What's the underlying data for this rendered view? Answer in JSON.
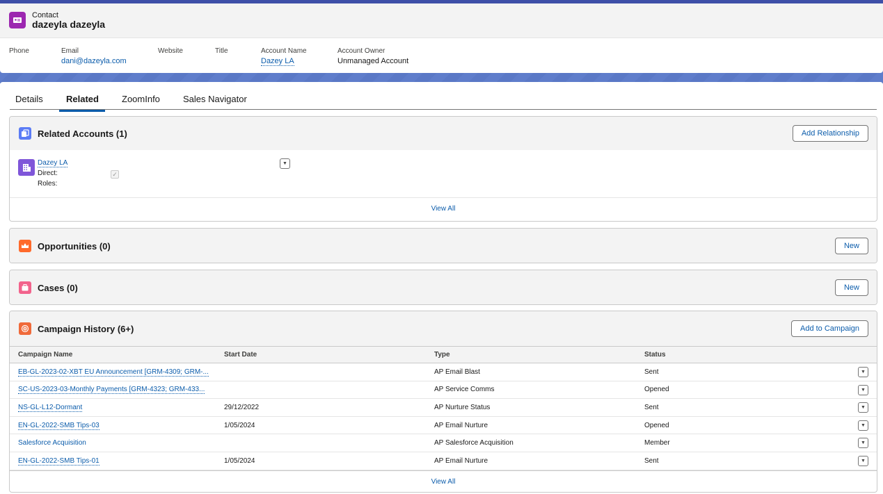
{
  "header": {
    "object_type": "Contact",
    "record_name": "dazeyla dazeyla",
    "fields": [
      {
        "label": "Phone",
        "value": ""
      },
      {
        "label": "Email",
        "value": "dani@dazeyla.com"
      },
      {
        "label": "Website",
        "value": ""
      },
      {
        "label": "Title",
        "value": ""
      },
      {
        "label": "Account Name",
        "value": "Dazey LA"
      },
      {
        "label": "Account Owner",
        "value": "Unmanaged Account"
      }
    ]
  },
  "tabs": [
    {
      "label": "Details"
    },
    {
      "label": "Related",
      "active": true
    },
    {
      "label": "ZoomInfo"
    },
    {
      "label": "Sales Navigator"
    }
  ],
  "related_accounts": {
    "title": "Related Accounts (1)",
    "button": "Add Relationship",
    "item": {
      "name": "Dazey LA",
      "direct_label": "Direct:",
      "roles_label": "Roles:",
      "direct_checked": true
    },
    "view_all": "View All"
  },
  "opportunities": {
    "title": "Opportunities (0)",
    "button": "New"
  },
  "cases": {
    "title": "Cases (0)",
    "button": "New"
  },
  "campaign_history": {
    "title": "Campaign History (6+)",
    "button": "Add to Campaign",
    "columns": [
      "Campaign Name",
      "Start Date",
      "Type",
      "Status"
    ],
    "rows": [
      {
        "name": "EB-GL-2023-02-XBT EU Announcement [GRM-4309; GRM-...",
        "start": "",
        "type": "AP Email Blast",
        "status": "Sent"
      },
      {
        "name": "SC-US-2023-03-Monthly Payments [GRM-4323; GRM-433...",
        "start": "",
        "type": "AP Service Comms",
        "status": "Opened"
      },
      {
        "name": "NS-GL-L12-Dormant",
        "start": "29/12/2022",
        "type": "AP Nurture Status",
        "status": "Sent"
      },
      {
        "name": "EN-GL-2022-SMB Tips-03",
        "start": "1/05/2024",
        "type": "AP Email Nurture",
        "status": "Opened"
      },
      {
        "name": "Salesforce Acquisition",
        "start": "",
        "type": "AP Salesforce Acquisition",
        "status": "Member"
      },
      {
        "name": "EN-GL-2022-SMB Tips-01",
        "start": "1/05/2024",
        "type": "AP Email Nurture",
        "status": "Sent"
      }
    ],
    "view_all": "View All"
  },
  "icons": {
    "contact": "contact-card-icon",
    "related_accounts": "related-list-icon",
    "account": "building-icon",
    "opportunities": "crown-icon",
    "cases": "briefcase-icon",
    "campaign": "target-icon",
    "dropdown": "chevron-down-icon"
  },
  "colors": {
    "link": "#0b5cab",
    "contact_icon": "#9c27b0",
    "related_icon": "#5b7cf5",
    "account_icon": "#7f56d9",
    "opportunity_icon": "#ff6a2b",
    "case_icon": "#f2638c",
    "campaign_icon": "#f06a3a"
  }
}
